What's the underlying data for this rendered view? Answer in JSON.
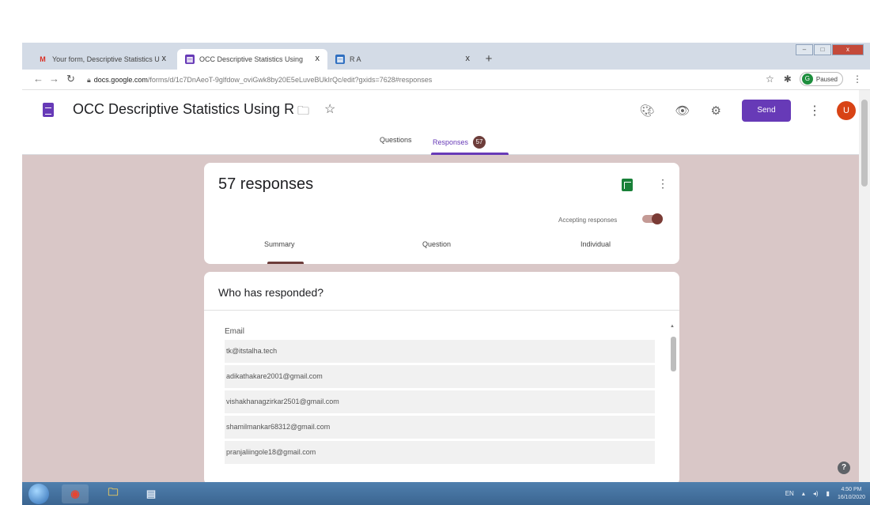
{
  "browser": {
    "tabs": [
      {
        "favicon": "M",
        "title": "Your form, Descriptive Statistics U",
        "close": "x"
      },
      {
        "favicon": "▤",
        "title": "OCC Descriptive Statistics Using",
        "close": "x"
      },
      {
        "favicon": "▤",
        "title": "R A",
        "close": "x"
      }
    ],
    "new_tab": "+",
    "window_controls": {
      "minimize": "–",
      "maximize": "□",
      "close": "x"
    },
    "url_host": "docs.google.com",
    "url_path": "/forms/d/1c7DnAeoT-9glfdow_oviGwk8by20E5eLuveBUkIrQc/edit?gxids=7628#responses",
    "paused_label": "Paused",
    "profile_initial": "G"
  },
  "form": {
    "title": "OCC Descriptive Statistics Using R",
    "send_label": "Send",
    "avatar_initial": "U",
    "tabs": {
      "questions": "Questions",
      "responses": "Responses",
      "responses_count": "57"
    }
  },
  "responses_card": {
    "count_label": "57 responses",
    "accepting_label": "Accepting responses",
    "accepting": true,
    "subtabs": {
      "summary": "Summary",
      "question": "Question",
      "individual": "Individual"
    }
  },
  "who_card": {
    "title": "Who has responded?",
    "column_header": "Email",
    "emails": [
      "tk@itstalha.tech",
      "adikathakare2001@gmail.com",
      "vishakhanagzirkar2501@gmail.com",
      "shamilmankar68312@gmail.com",
      "pranjaliingole18@gmail.com"
    ]
  },
  "taskbar": {
    "language": "EN",
    "time": "4:50 PM",
    "date": "16/10/2020"
  },
  "colors": {
    "accent": "#673ab7",
    "theme_bg": "#d9c7c7",
    "theme_dark": "#6d3d3a"
  },
  "icons": [
    "back-icon",
    "forward-icon",
    "reload-icon",
    "lock-icon",
    "star-icon",
    "extension-icon",
    "folder-icon",
    "palette-icon",
    "preview-eye-icon",
    "settings-gear-icon",
    "more-vert-icon",
    "sheets-icon",
    "help-icon",
    "windows-start-icon",
    "chrome-icon",
    "explorer-icon"
  ]
}
